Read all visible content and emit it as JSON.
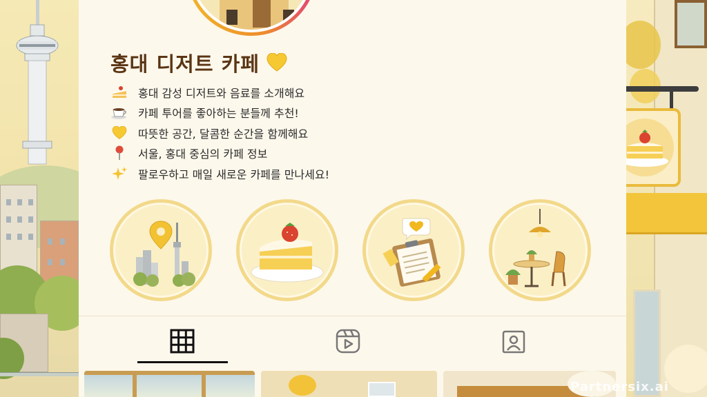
{
  "profile": {
    "name": "홍대 디저트 카페",
    "name_emoji": "💛",
    "bio": [
      {
        "icon": "cake-icon",
        "emoji": "🍰",
        "text": "홍대 감성 디저트와 음료를 소개해요"
      },
      {
        "icon": "coffee-cup-icon",
        "emoji": "☕",
        "text": "카페 투어를 좋아하는 분들께 추천!"
      },
      {
        "icon": "yellow-heart-icon",
        "emoji": "💛",
        "text": "따뜻한 공간, 달콤한 순간을 함께해요"
      },
      {
        "icon": "location-pin-icon",
        "emoji": "📍",
        "text": "서울, 홍대 중심의 카페 정보"
      },
      {
        "icon": "sparkles-icon",
        "emoji": "✨",
        "text": "팔로우하고 매일 새로운 카페를 만나세요!"
      }
    ]
  },
  "highlights": [
    {
      "icon": "city-location-icon"
    },
    {
      "icon": "strawberry-cake-icon"
    },
    {
      "icon": "clipboard-review-icon"
    },
    {
      "icon": "cafe-table-icon"
    }
  ],
  "tabs": [
    {
      "icon": "grid-icon",
      "active": true
    },
    {
      "icon": "reels-icon",
      "active": false
    },
    {
      "icon": "tagged-icon",
      "active": false
    }
  ],
  "watermark": "Partnersix.ai",
  "colors": {
    "panel": "#fdf8ec",
    "accent_yellow": "#f2d98a",
    "title_brown": "#5a3514",
    "active_tab": "#111111"
  }
}
